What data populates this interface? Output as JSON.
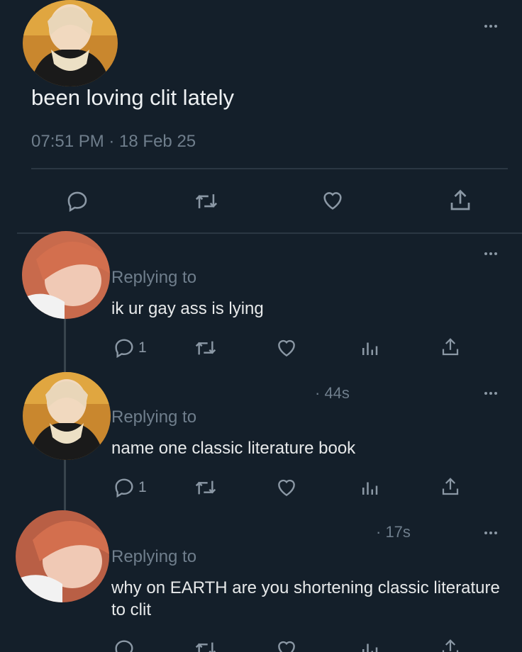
{
  "main_post": {
    "text": "been loving clit lately",
    "timestamp": "07:51 PM · 18 Feb 25"
  },
  "replies": [
    {
      "replying_label": "Replying to",
      "text": "ik ur gay ass is lying",
      "time": "",
      "reply_count": "1"
    },
    {
      "replying_label": "Replying to",
      "text": "name one classic literature book",
      "time": "· 44s",
      "reply_count": "1"
    },
    {
      "replying_label": "Replying to",
      "text": "why on EARTH are you shortening classic literature to clit",
      "time": "· 17s",
      "reply_count": ""
    }
  ],
  "icons": [
    "more-icon",
    "reply-icon",
    "retweet-icon",
    "like-icon",
    "share-icon",
    "analytics-icon"
  ],
  "colors": {
    "background": "#141f2a",
    "text": "#e7e9ea",
    "muted": "#6f7e8c",
    "divider": "#2b3743"
  }
}
